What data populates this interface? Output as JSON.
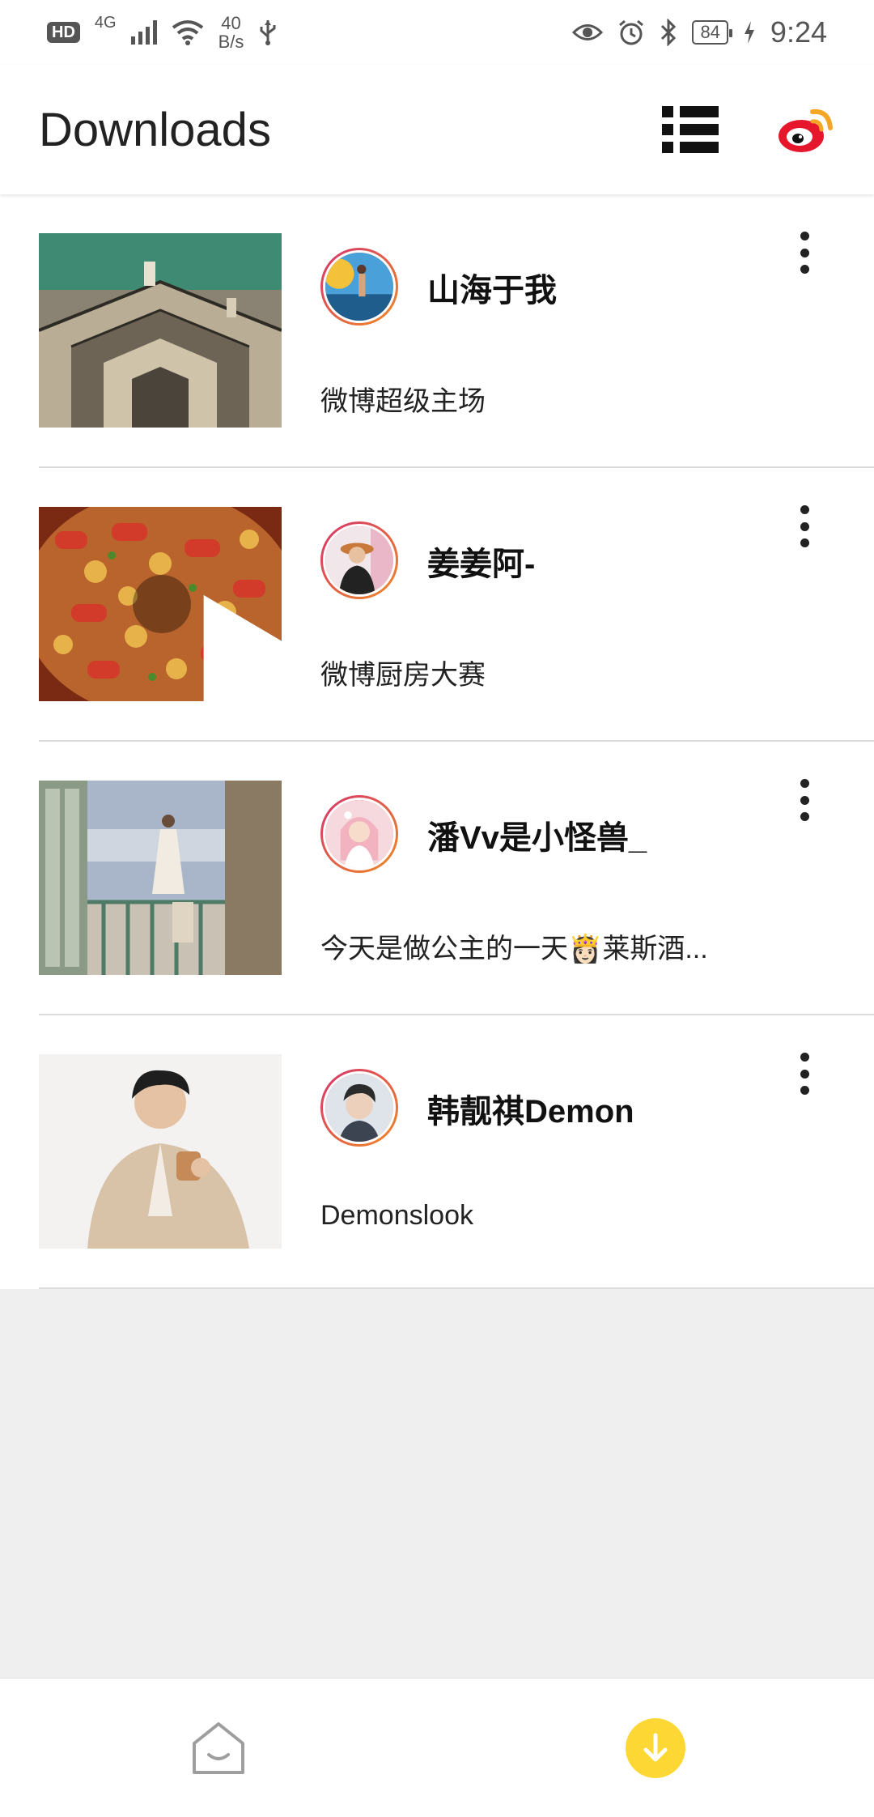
{
  "status_bar": {
    "hd": "HD",
    "network": "4G",
    "speed_value": "40",
    "speed_unit": "B/s",
    "battery": "84",
    "time": "9:24"
  },
  "app_bar": {
    "title": "Downloads",
    "list_view_icon": "list-view-icon",
    "weibo_icon": "weibo-logo-icon",
    "weibo_color": "#e6162d"
  },
  "downloads": [
    {
      "username": "山海于我",
      "caption": "微博超级主场",
      "has_video": false
    },
    {
      "username": "姜姜阿-",
      "caption": "微博厨房大赛",
      "has_video": true
    },
    {
      "username": "潘Vv是小怪兽_",
      "caption": "今天是做公主的一天👸🏻莱斯酒...",
      "has_video": false
    },
    {
      "username": "韩靓祺Demon",
      "caption": "Demonslook",
      "has_video": false
    }
  ],
  "bottom_nav": {
    "home_icon": "home-icon",
    "downloads_icon": "download-icon",
    "accent_color": "#fdd835"
  }
}
